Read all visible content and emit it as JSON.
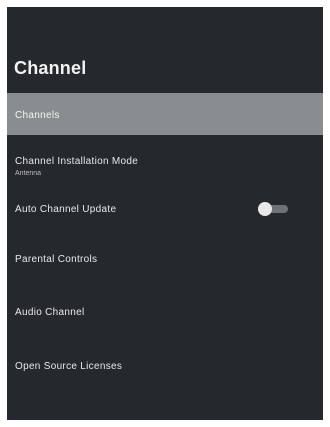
{
  "header": {
    "title": "Channel"
  },
  "menu": {
    "items": [
      {
        "label": "Channels"
      },
      {
        "label": "Channel Installation Mode",
        "sublabel": "Antenna"
      },
      {
        "label": "Auto Channel Update",
        "toggle_state": "off"
      },
      {
        "label": "Parental Controls"
      },
      {
        "label": "Audio Channel"
      },
      {
        "label": "Open Source Licenses"
      }
    ],
    "selected_index": 0
  },
  "colors": {
    "panel_background": "#25282d",
    "selected_background": "#8a8d8f",
    "text": "#e8e8e8"
  }
}
